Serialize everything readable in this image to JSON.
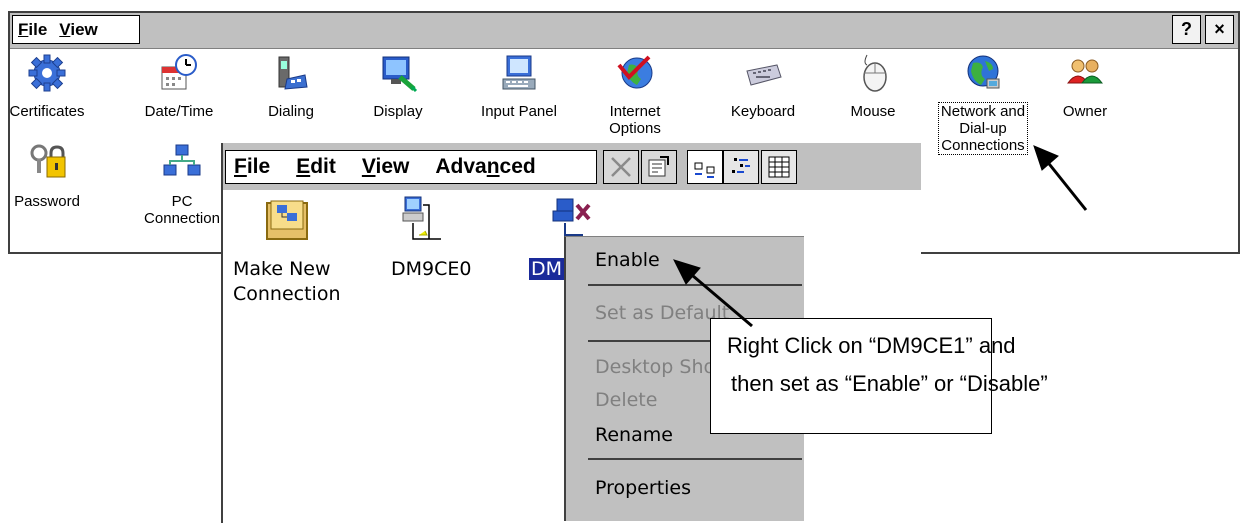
{
  "control_panel": {
    "menu": [
      {
        "label": "File",
        "accel": "F"
      },
      {
        "label": "View",
        "accel": "V"
      }
    ],
    "help_button": "?",
    "close_button": "×",
    "items": [
      {
        "name": "certificates",
        "label": "Certificates",
        "icon": "gear-icon"
      },
      {
        "name": "date-time",
        "label": "Date/Time",
        "icon": "calendar-clock-icon"
      },
      {
        "name": "dialing",
        "label": "Dialing",
        "icon": "phone-icon"
      },
      {
        "name": "display",
        "label": "Display",
        "icon": "monitor-icon"
      },
      {
        "name": "input-panel",
        "label": "Input Panel",
        "icon": "keyboard-monitor-icon"
      },
      {
        "name": "internet-options",
        "label": "Internet\nOptions",
        "icon": "globe-check-icon"
      },
      {
        "name": "keyboard",
        "label": "Keyboard",
        "icon": "keyboard-icon"
      },
      {
        "name": "mouse",
        "label": "Mouse",
        "icon": "mouse-icon"
      },
      {
        "name": "network-dialup",
        "label": "Network and\nDial-up\nConnections",
        "icon": "globe-network-icon"
      },
      {
        "name": "owner",
        "label": "Owner",
        "icon": "people-icon"
      },
      {
        "name": "password",
        "label": "Password",
        "icon": "keys-lock-icon"
      },
      {
        "name": "pc-connection",
        "label": "PC\nConnection",
        "icon": "network-computers-icon"
      }
    ]
  },
  "network_window": {
    "menu": [
      {
        "label": "File",
        "accel": "F"
      },
      {
        "label": "Edit",
        "accel": "E"
      },
      {
        "label": "View",
        "accel": "V"
      },
      {
        "label": "Advanced",
        "accel": "n"
      }
    ],
    "toolbar": [
      "delete-icon",
      "properties-icon",
      "large-icons-icon",
      "list-icon",
      "details-icon"
    ],
    "items": [
      {
        "name": "make-new-connection",
        "label": "Make New\nConnection",
        "icon": "new-connection-icon"
      },
      {
        "name": "dm9ce0",
        "label": "DM9CE0",
        "icon": "network-connection-icon"
      },
      {
        "name": "dm9ce1",
        "label": "DM",
        "icon": "network-disabled-icon",
        "selected": true
      }
    ]
  },
  "context_menu": {
    "items": [
      {
        "label": "Enable",
        "enabled": true
      },
      {
        "label": "Set as Default",
        "enabled": false
      },
      {
        "label": "Desktop Shortcut",
        "enabled": false
      },
      {
        "label": "Delete",
        "enabled": false
      },
      {
        "label": "Rename",
        "enabled": true
      },
      {
        "label": "Properties",
        "enabled": true
      }
    ]
  },
  "callout": {
    "line1": "Right Click on “DM9CE1” and",
    "line2": "then set as “Enable” or “Disable”"
  }
}
